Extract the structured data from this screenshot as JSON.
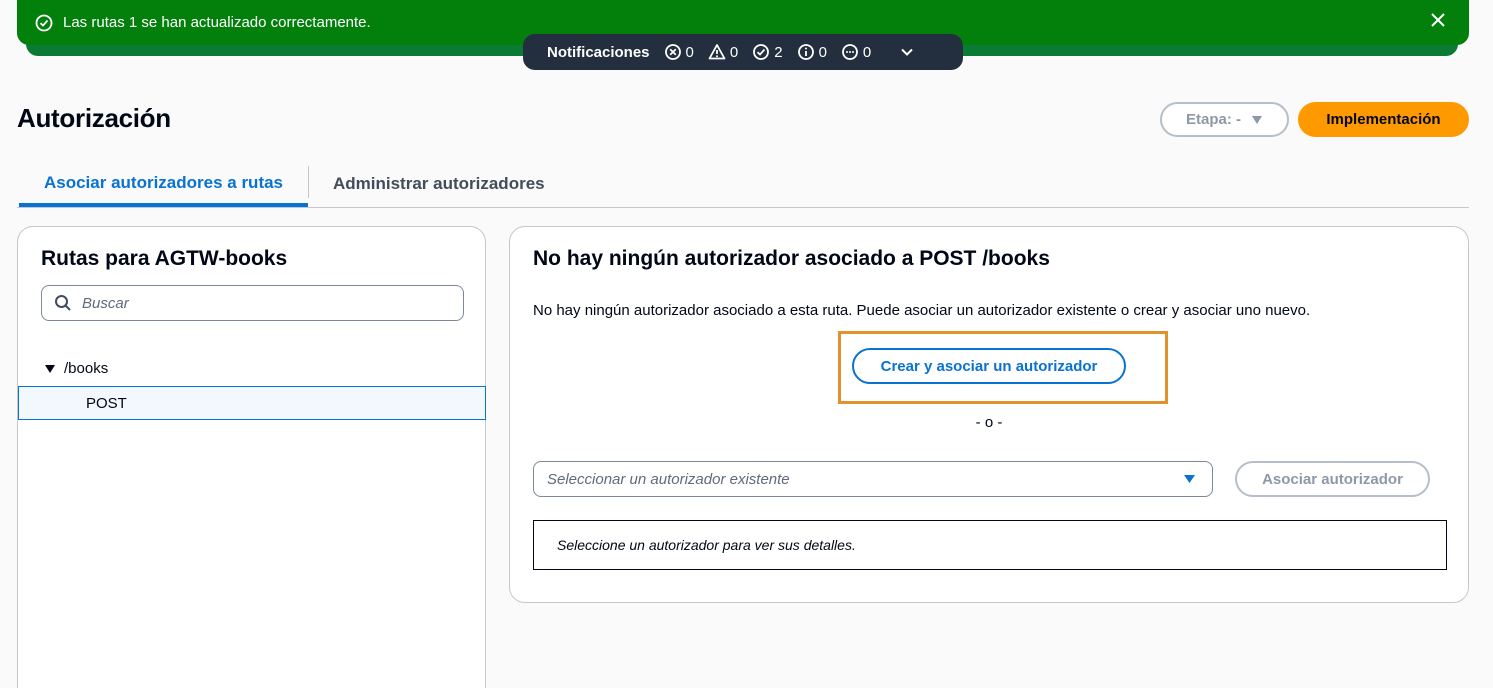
{
  "flash": {
    "message": "Las rutas 1 se han actualizado correctamente.",
    "icons": {
      "status": "check-circle-icon",
      "dismiss": "close-icon"
    },
    "color": "#037f0c"
  },
  "notifications": {
    "title": "Notificaciones",
    "error_count": "0",
    "warning_count": "0",
    "success_count": "2",
    "info_count": "0",
    "in_progress_count": "0"
  },
  "header": {
    "title": "Autorización",
    "stage_label": "Etapa: -",
    "deploy_label": "Implementación",
    "accent_color": "#ff9900"
  },
  "tabs": [
    {
      "label": "Asociar autorizadores a rutas",
      "active": true
    },
    {
      "label": "Administrar autorizadores",
      "active": false
    }
  ],
  "routes_panel": {
    "title": "Rutas para AGTW-books",
    "search_placeholder": "Buscar",
    "tree": {
      "root": "/books",
      "children": [
        "POST"
      ]
    }
  },
  "auth_panel": {
    "title": "No hay ningún autorizador asociado a POST /books",
    "description": "No hay ningún autorizador asociado a esta ruta. Puede asociar un autorizador existente o crear y asociar uno nuevo.",
    "create_button": "Crear y asociar un autorizador",
    "or_separator": "- o -",
    "select_placeholder": "Seleccionar un autorizador existente",
    "associate_button": "Asociar autorizador",
    "details_text": "Seleccione un autorizador para ver sus detalles."
  }
}
